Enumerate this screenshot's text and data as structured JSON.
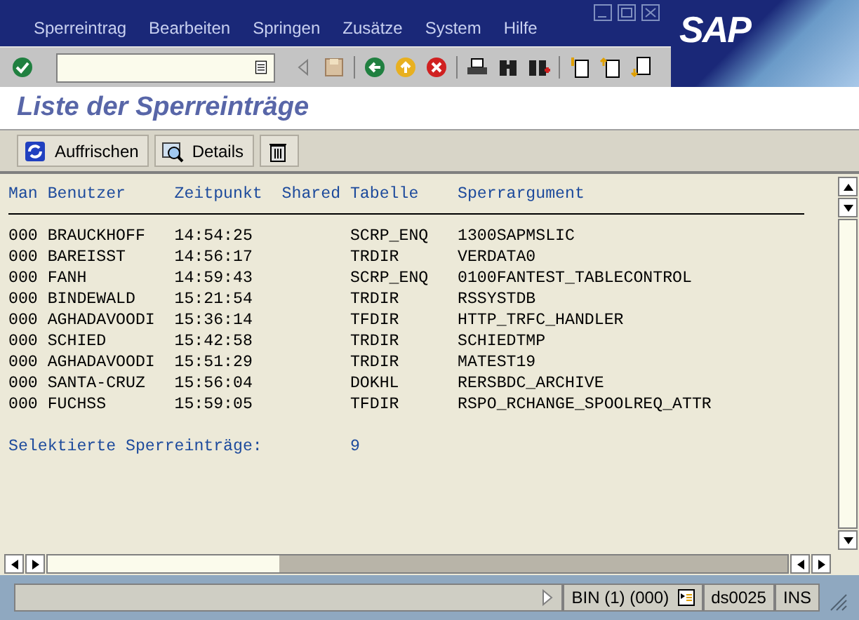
{
  "menu": [
    {
      "label": "Sperreintrag"
    },
    {
      "label": "Bearbeiten"
    },
    {
      "label": "Springen"
    },
    {
      "label": "Zusätze"
    },
    {
      "label": "System"
    },
    {
      "label": "Hilfe"
    }
  ],
  "logo": "SAP",
  "title": "Liste der Sperreinträge",
  "app_buttons": [
    {
      "kind": "refresh",
      "label": "Auffrischen"
    },
    {
      "kind": "details",
      "label": "Details"
    },
    {
      "kind": "delete"
    }
  ],
  "table": {
    "columns": [
      "Man",
      "Benutzer",
      "Zeitpunkt",
      "Shared",
      "Tabelle",
      "Sperrargument"
    ],
    "rows": [
      [
        "000",
        "BRAUCKHOFF",
        "14:54:25",
        "",
        "SCRP_ENQ",
        "1300SAPMSLIC"
      ],
      [
        "000",
        "BAREISST",
        "14:56:17",
        "",
        "TRDIR",
        "VERDATA0"
      ],
      [
        "000",
        "FANH",
        "14:59:43",
        "",
        "SCRP_ENQ",
        "0100FANTEST_TABLECONTROL"
      ],
      [
        "000",
        "BINDEWALD",
        "15:21:54",
        "",
        "TRDIR",
        "RSSYSTDB"
      ],
      [
        "000",
        "AGHADAVOODI",
        "15:36:14",
        "",
        "TFDIR",
        "HTTP_TRFC_HANDLER"
      ],
      [
        "000",
        "SCHIED",
        "15:42:58",
        "",
        "TRDIR",
        "SCHIEDTMP"
      ],
      [
        "000",
        "AGHADAVOODI",
        "15:51:29",
        "",
        "TRDIR",
        "MATEST19"
      ],
      [
        "000",
        "SANTA-CRUZ",
        "15:56:04",
        "",
        "DOKHL",
        "RERSBDC_ARCHIVE"
      ],
      [
        "000",
        "FUCHSS",
        "15:59:05",
        "",
        "TFDIR",
        "RSPO_RCHANGE_SPOOLREQ_ATTR"
      ]
    ]
  },
  "summary": {
    "label": "Selektierte Sperreinträge:",
    "value": "9"
  },
  "status_bar": {
    "system": "BIN (1) (000)",
    "server": "ds0025",
    "mode": "INS"
  }
}
